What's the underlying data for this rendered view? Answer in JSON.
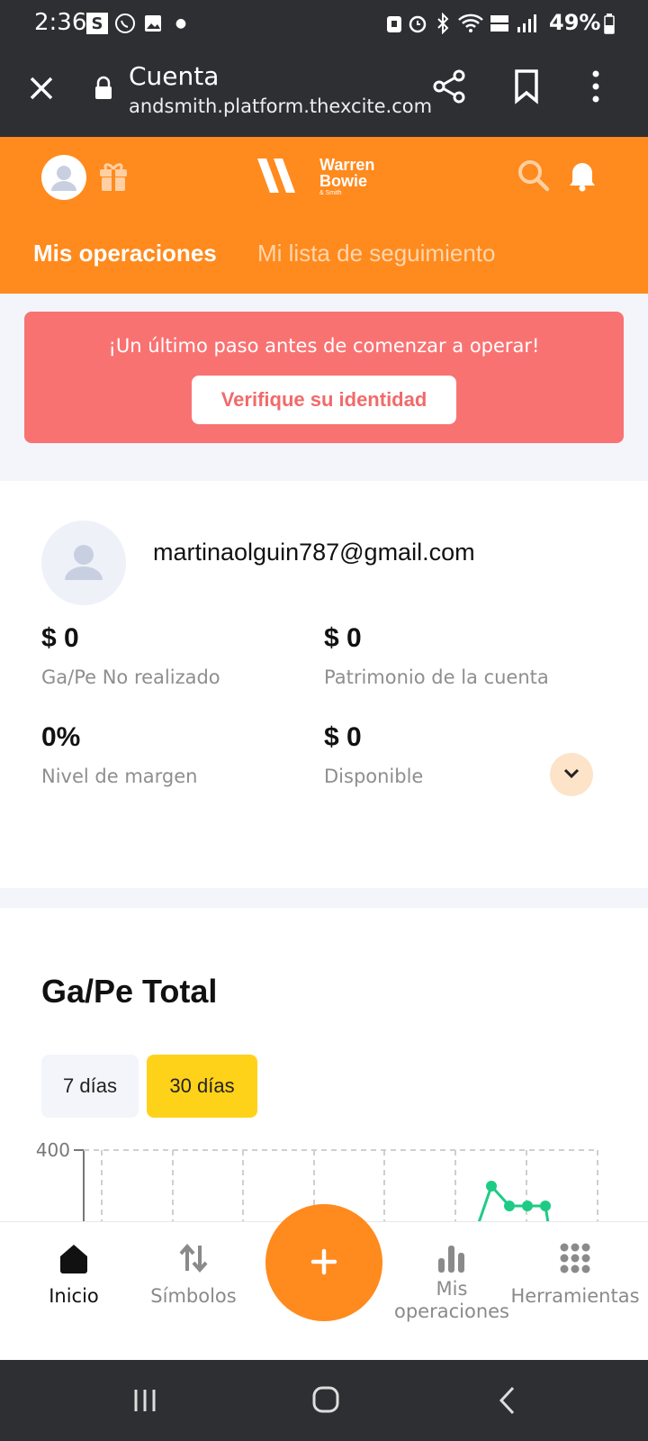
{
  "status_bar": {
    "time": "2:36",
    "battery": "49%"
  },
  "browser": {
    "title": "Cuenta",
    "url": "andsmith.platform.thexcite.com"
  },
  "header": {
    "brand_line1": "Warren",
    "brand_line2": "Bowie",
    "brand_line3": "& Smith",
    "tabs": [
      {
        "label": "Mis operaciones"
      },
      {
        "label": "Mi lista de seguimiento"
      }
    ],
    "accent": "#ff8a1d"
  },
  "alert": {
    "message": "¡Un último paso antes de comenzar a operar!",
    "button_label": "Verifique su identidad"
  },
  "account": {
    "email": "martinaolguin787@gmail.com",
    "stats": [
      {
        "value": "$ 0",
        "label": "Ga/Pe No realizado"
      },
      {
        "value": "$ 0",
        "label": "Patrimonio de la cuenta"
      },
      {
        "value": "0%",
        "label": "Nivel de margen"
      },
      {
        "value": "$ 0",
        "label": "Disponible"
      }
    ]
  },
  "pnl": {
    "title": "Ga/Pe Total",
    "periods": [
      "7 días",
      "30 días"
    ],
    "selected_period": "30 días"
  },
  "chart_data": {
    "type": "line",
    "y_tick_labels": [
      "400"
    ],
    "series": [
      {
        "values": [
          350,
          400,
          380,
          380,
          380
        ]
      }
    ],
    "grid": true
  },
  "bottom_nav": {
    "items": [
      {
        "label": "Inicio"
      },
      {
        "label": "Símbolos"
      },
      {
        "label": "Mis\noperaciones"
      },
      {
        "label": "Herramientas"
      }
    ]
  }
}
